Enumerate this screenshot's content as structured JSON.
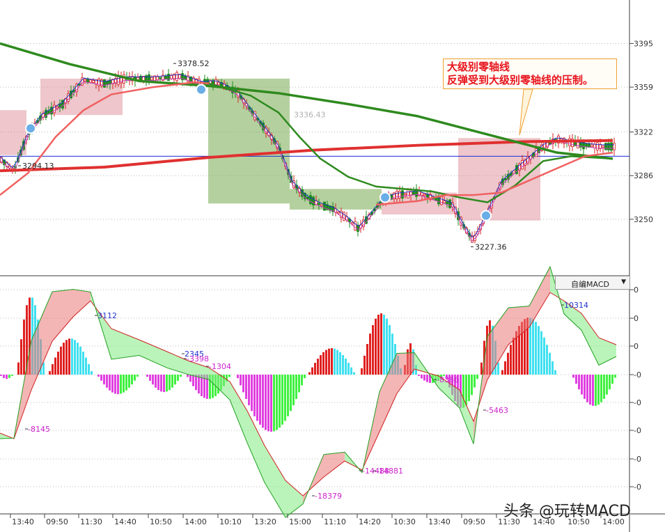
{
  "chart_data": [
    {
      "type": "line",
      "panel": "price",
      "y_ticks": [
        "3395",
        "3359",
        "3322",
        "3286",
        "3250"
      ],
      "y_tick_values": [
        3395,
        3359,
        3322,
        3286,
        3250
      ],
      "ylim": [
        3208,
        3428
      ],
      "reference_level": 3302,
      "annotations": [
        {
          "text": "3378.52",
          "value": 3378.52
        },
        {
          "text": "3336.43",
          "value": 3336.43
        },
        {
          "text": "3294.13",
          "value": 3294.13
        },
        {
          "text": "3227.36",
          "value": 3227.36
        }
      ],
      "callout": [
        "大级别零轴线",
        "反弹受到大级别零轴线的压制。"
      ],
      "series": [
        {
          "color": "#e03030",
          "role": "long-term average (red, thick)",
          "points": [
            [
              0,
              3290
            ],
            [
              150,
              3293
            ],
            [
              300,
              3301
            ],
            [
              450,
              3307
            ],
            [
              600,
              3311
            ],
            [
              750,
              3314
            ],
            [
              880,
              3315
            ]
          ]
        },
        {
          "color": "#2e8a1e",
          "role": "long-term average (green)",
          "points": [
            [
              0,
              3395
            ],
            [
              100,
              3378
            ],
            [
              200,
              3364
            ],
            [
              300,
              3360
            ],
            [
              400,
              3354
            ],
            [
              500,
              3345
            ],
            [
              600,
              3335
            ],
            [
              700,
              3320
            ],
            [
              800,
              3305
            ],
            [
              880,
              3300
            ]
          ]
        },
        {
          "color": "#2e8a1e",
          "role": "medium average (green)",
          "points": [
            [
              300,
              3362
            ],
            [
              360,
              3352
            ],
            [
              400,
              3338
            ],
            [
              430,
              3318
            ],
            [
              460,
              3300
            ],
            [
              500,
              3285
            ],
            [
              540,
              3277
            ],
            [
              580,
              3275
            ],
            [
              620,
              3273
            ],
            [
              660,
              3268
            ],
            [
              700,
              3264
            ],
            [
              740,
              3278
            ],
            [
              780,
              3298
            ],
            [
              820,
              3302
            ],
            [
              880,
              3300
            ]
          ]
        },
        {
          "color": "#f06060",
          "role": "short average (light red)",
          "points": [
            [
              0,
              3270
            ],
            [
              40,
              3288
            ],
            [
              80,
              3318
            ],
            [
              120,
              3340
            ],
            [
              160,
              3353
            ],
            [
              220,
              3359
            ],
            [
              280,
              3363
            ],
            [
              300,
              3362
            ]
          ]
        },
        {
          "color": "#f06060",
          "role": "short average (light red)",
          "points": [
            [
              540,
              3262
            ],
            [
              600,
              3265
            ],
            [
              640,
              3270
            ],
            [
              680,
              3270
            ],
            [
              720,
              3272
            ],
            [
              760,
              3282
            ],
            [
              800,
              3292
            ],
            [
              840,
              3302
            ],
            [
              880,
              3305
            ]
          ]
        }
      ],
      "zones": [
        {
          "color": "pink",
          "x0": 0,
          "x1": 38,
          "y0": 3340,
          "y1": 3303
        },
        {
          "color": "pink",
          "x0": 58,
          "x1": 176,
          "y0": 3366,
          "y1": 3336
        },
        {
          "color": "green",
          "x0": 299,
          "x1": 416,
          "y0": 3366,
          "y1": 3263
        },
        {
          "color": "green",
          "x0": 416,
          "x1": 548,
          "y0": 3275,
          "y1": 3258
        },
        {
          "color": "pink",
          "x0": 548,
          "x1": 656,
          "y0": 3272,
          "y1": 3254
        },
        {
          "color": "pink",
          "x0": 658,
          "x1": 776,
          "y0": 3317,
          "y1": 3249
        }
      ]
    },
    {
      "type": "bar",
      "panel": "macd",
      "indicator_label": "自编MACD",
      "y_ticks": [
        "0",
        "0",
        "0",
        "-0",
        "-0",
        "-0",
        "-0",
        "-0"
      ],
      "annotations": [
        "-8145",
        "-5463",
        "-18379",
        "-14488",
        "-14881",
        "10314",
        "3112",
        "2345",
        "-3398",
        "-1304",
        "-8386"
      ],
      "histogram_segments": [
        {
          "x0": 0,
          "x1": 22,
          "peak": -6
        },
        {
          "x0": 25,
          "x1": 68,
          "peak": 112
        },
        {
          "x0": 70,
          "x1": 135,
          "peak": 52
        },
        {
          "x0": 140,
          "x1": 200,
          "peak": -28
        },
        {
          "x0": 210,
          "x1": 265,
          "peak": -25
        },
        {
          "x0": 268,
          "x1": 335,
          "peak": -35
        },
        {
          "x0": 340,
          "x1": 440,
          "peak": -82
        },
        {
          "x0": 443,
          "x1": 512,
          "peak": 38
        },
        {
          "x0": 518,
          "x1": 578,
          "peak": 88
        },
        {
          "x0": 580,
          "x1": 600,
          "peak": 45
        },
        {
          "x0": 600,
          "x1": 640,
          "peak": -12
        },
        {
          "x0": 640,
          "x1": 688,
          "peak": -48
        },
        {
          "x0": 690,
          "x1": 718,
          "peak": 78
        },
        {
          "x0": 720,
          "x1": 800,
          "peak": 82
        },
        {
          "x0": 822,
          "x1": 886,
          "peak": -45
        }
      ]
    }
  ],
  "x_axis_labels": [
    "13:40",
    "09:50",
    "11:30",
    "14:40",
    "10:50",
    "14:00",
    "10:10",
    "13:20",
    "15:00",
    "11:10",
    "14:20",
    "10:30",
    "13:40",
    "09:50",
    "11:30",
    "14:40",
    "10:50",
    "14:00"
  ],
  "watermark": "头条 @玩转MACD"
}
